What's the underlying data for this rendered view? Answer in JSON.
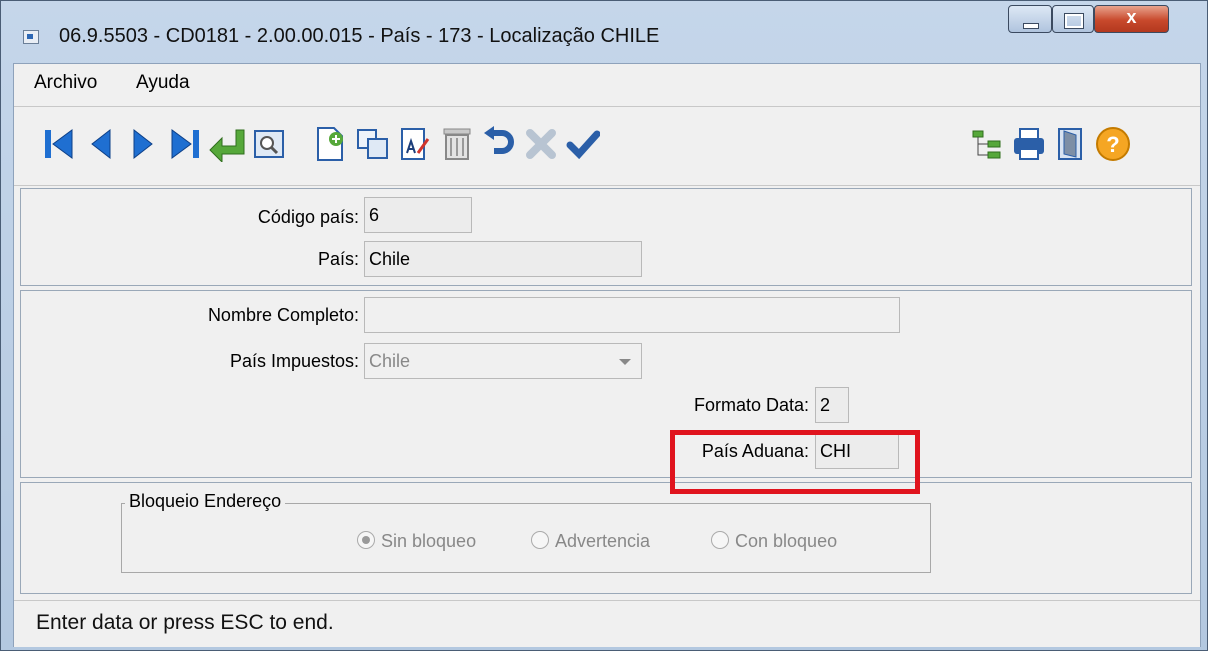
{
  "window": {
    "title": "06.9.5503 - CD0181 - 2.00.00.015 - País - 173 - Localização CHILE",
    "close_glyph": "x"
  },
  "menu": {
    "items": [
      {
        "label": "Archivo"
      },
      {
        "label": "Ayuda"
      }
    ]
  },
  "toolbar": {
    "left_icons": [
      "first-record-icon",
      "prev-record-icon",
      "next-record-icon",
      "last-record-icon",
      "goto-icon",
      "search-icon",
      "new-record-icon",
      "copy-record-icon",
      "edit-record-icon",
      "delete-record-icon",
      "undo-icon",
      "cancel-icon",
      "save-icon"
    ],
    "right_icons": [
      "tree-icon",
      "print-icon",
      "exit-icon",
      "help-icon"
    ],
    "help_glyph": "?"
  },
  "form": {
    "codigo_pais": {
      "label": "Código país:",
      "value": "6"
    },
    "pais": {
      "label": "País:",
      "value": "Chile"
    },
    "nombre_completo": {
      "label": "Nombre Completo:",
      "value": ""
    },
    "pais_impuestos": {
      "label": "País Impuestos:",
      "value": "Chile"
    },
    "formato_data": {
      "label": "Formato Data:",
      "value": "2"
    },
    "pais_aduana": {
      "label": "País Aduana:",
      "value": "CHI"
    }
  },
  "bloqueio": {
    "title": "Bloqueio Endereço",
    "options": [
      {
        "label": "Sin bloqueo",
        "selected": true
      },
      {
        "label": "Advertencia",
        "selected": false
      },
      {
        "label": "Con bloqueo",
        "selected": false
      }
    ]
  },
  "status": {
    "text": "Enter data or press ESC to end."
  },
  "colors": {
    "highlight": "#e0141e",
    "nav_blue": "#1f6fd1",
    "accent_green": "#56a83a",
    "help_orange": "#f5a623"
  }
}
